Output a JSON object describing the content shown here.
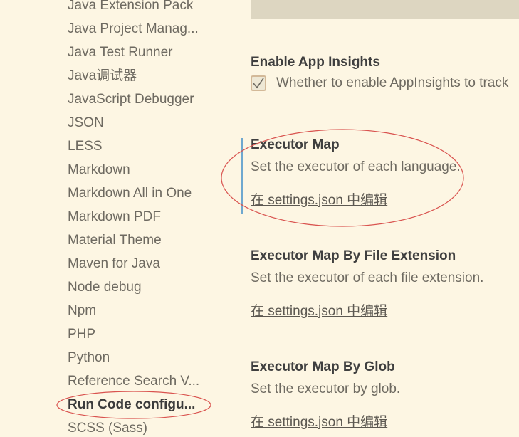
{
  "toc": {
    "items": [
      {
        "label": "Java Extension Pack"
      },
      {
        "label": "Java Project Manag..."
      },
      {
        "label": "Java Test Runner"
      },
      {
        "label": "Java调试器"
      },
      {
        "label": "JavaScript Debugger"
      },
      {
        "label": "JSON"
      },
      {
        "label": "LESS"
      },
      {
        "label": "Markdown"
      },
      {
        "label": "Markdown All in One"
      },
      {
        "label": "Markdown PDF"
      },
      {
        "label": "Material Theme"
      },
      {
        "label": "Maven for Java"
      },
      {
        "label": "Node debug"
      },
      {
        "label": "Npm"
      },
      {
        "label": "PHP"
      },
      {
        "label": "Python"
      },
      {
        "label": "Reference Search V..."
      },
      {
        "label": "Run Code configu...",
        "active": true
      },
      {
        "label": "SCSS (Sass)"
      }
    ]
  },
  "settings": {
    "app_insights": {
      "title": "Enable App Insights",
      "checked": true,
      "description": "Whether to enable AppInsights to track"
    },
    "executor_map": {
      "title": "Executor Map",
      "description": "Set the executor of each language.",
      "link": "在 settings.json 中编辑"
    },
    "executor_map_ext": {
      "title": "Executor Map By File Extension",
      "description": "Set the executor of each file extension.",
      "link": "在 settings.json 中编辑"
    },
    "executor_map_glob": {
      "title": "Executor Map By Glob",
      "description": "Set the executor by glob.",
      "link": "在 settings.json 中编辑"
    }
  },
  "colors": {
    "background": "#fdf6e3",
    "focus_bar": "#6fa8cf",
    "annotation": "#d9534f"
  }
}
